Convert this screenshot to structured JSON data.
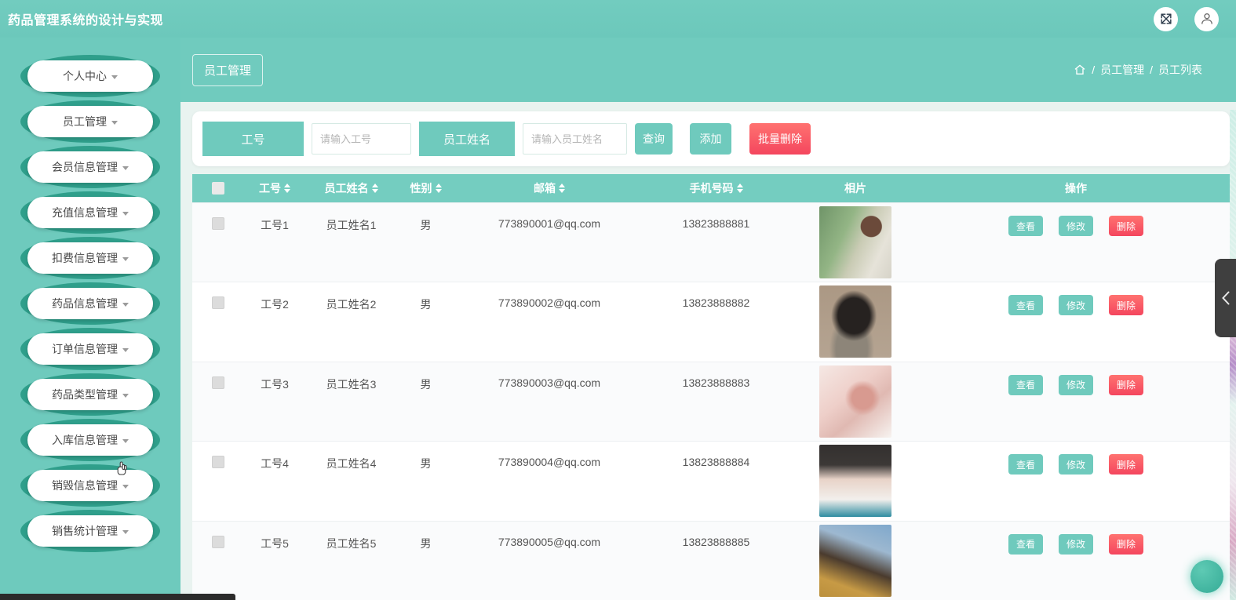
{
  "app": {
    "title": "药品管理系统的设计与实现"
  },
  "topbar": {
    "icons": [
      {
        "name": "fullscreen-icon"
      },
      {
        "name": "user-icon"
      }
    ]
  },
  "sidebar": {
    "items": [
      {
        "label": "个人中心"
      },
      {
        "label": "员工管理"
      },
      {
        "label": "会员信息管理"
      },
      {
        "label": "充值信息管理"
      },
      {
        "label": "扣费信息管理"
      },
      {
        "label": "药品信息管理"
      },
      {
        "label": "订单信息管理"
      },
      {
        "label": "药品类型管理"
      },
      {
        "label": "入库信息管理"
      },
      {
        "label": "销毁信息管理"
      },
      {
        "label": "销售统计管理"
      }
    ]
  },
  "header": {
    "tab": "员工管理",
    "breadcrumb": {
      "separator": "/",
      "items": [
        "员工管理",
        "员工列表"
      ]
    }
  },
  "search": {
    "fields": [
      {
        "label": "工号",
        "placeholder": "请输入工号"
      },
      {
        "label": "员工姓名",
        "placeholder": "请输入员工姓名"
      }
    ],
    "query_label": "查询",
    "add_label": "添加",
    "batch_delete_label": "批量删除"
  },
  "table": {
    "columns": [
      {
        "type": "checkbox",
        "label": ""
      },
      {
        "label": "工号",
        "sortable": true
      },
      {
        "label": "员工姓名",
        "sortable": true
      },
      {
        "label": "性别",
        "sortable": true
      },
      {
        "label": "邮箱",
        "sortable": true
      },
      {
        "label": "手机号码",
        "sortable": true
      },
      {
        "label": "相片",
        "sortable": false
      },
      {
        "label": "操作",
        "sortable": false
      }
    ],
    "rows": [
      {
        "id": "工号1",
        "name": "员工姓名1",
        "gender": "男",
        "email": "773890001@qq.com",
        "phone": "13823888881",
        "photo": "portrait-woman-green-outdoor"
      },
      {
        "id": "工号2",
        "name": "员工姓名2",
        "gender": "男",
        "email": "773890002@qq.com",
        "phone": "13823888882",
        "photo": "portrait-woman-black-top"
      },
      {
        "id": "工号3",
        "name": "员工姓名3",
        "gender": "男",
        "email": "773890003@qq.com",
        "phone": "13823888883",
        "photo": "portrait-woman-selfie"
      },
      {
        "id": "工号4",
        "name": "员工姓名4",
        "gender": "男",
        "email": "773890004@qq.com",
        "phone": "13823888884",
        "photo": "portrait-man-white-sweater"
      },
      {
        "id": "工号5",
        "name": "员工姓名5",
        "gender": "男",
        "email": "773890005@qq.com",
        "phone": "13823888885",
        "photo": "portrait-woman-yellow-jacket"
      }
    ],
    "actions": [
      "查看",
      "修改",
      "删除"
    ]
  },
  "colors": {
    "accent": "#6fcabd",
    "accent_dark": "#2f9f8b",
    "table_header": "#74cdc0",
    "danger": "#f4465e",
    "page_bg": "#e9f3f0"
  }
}
